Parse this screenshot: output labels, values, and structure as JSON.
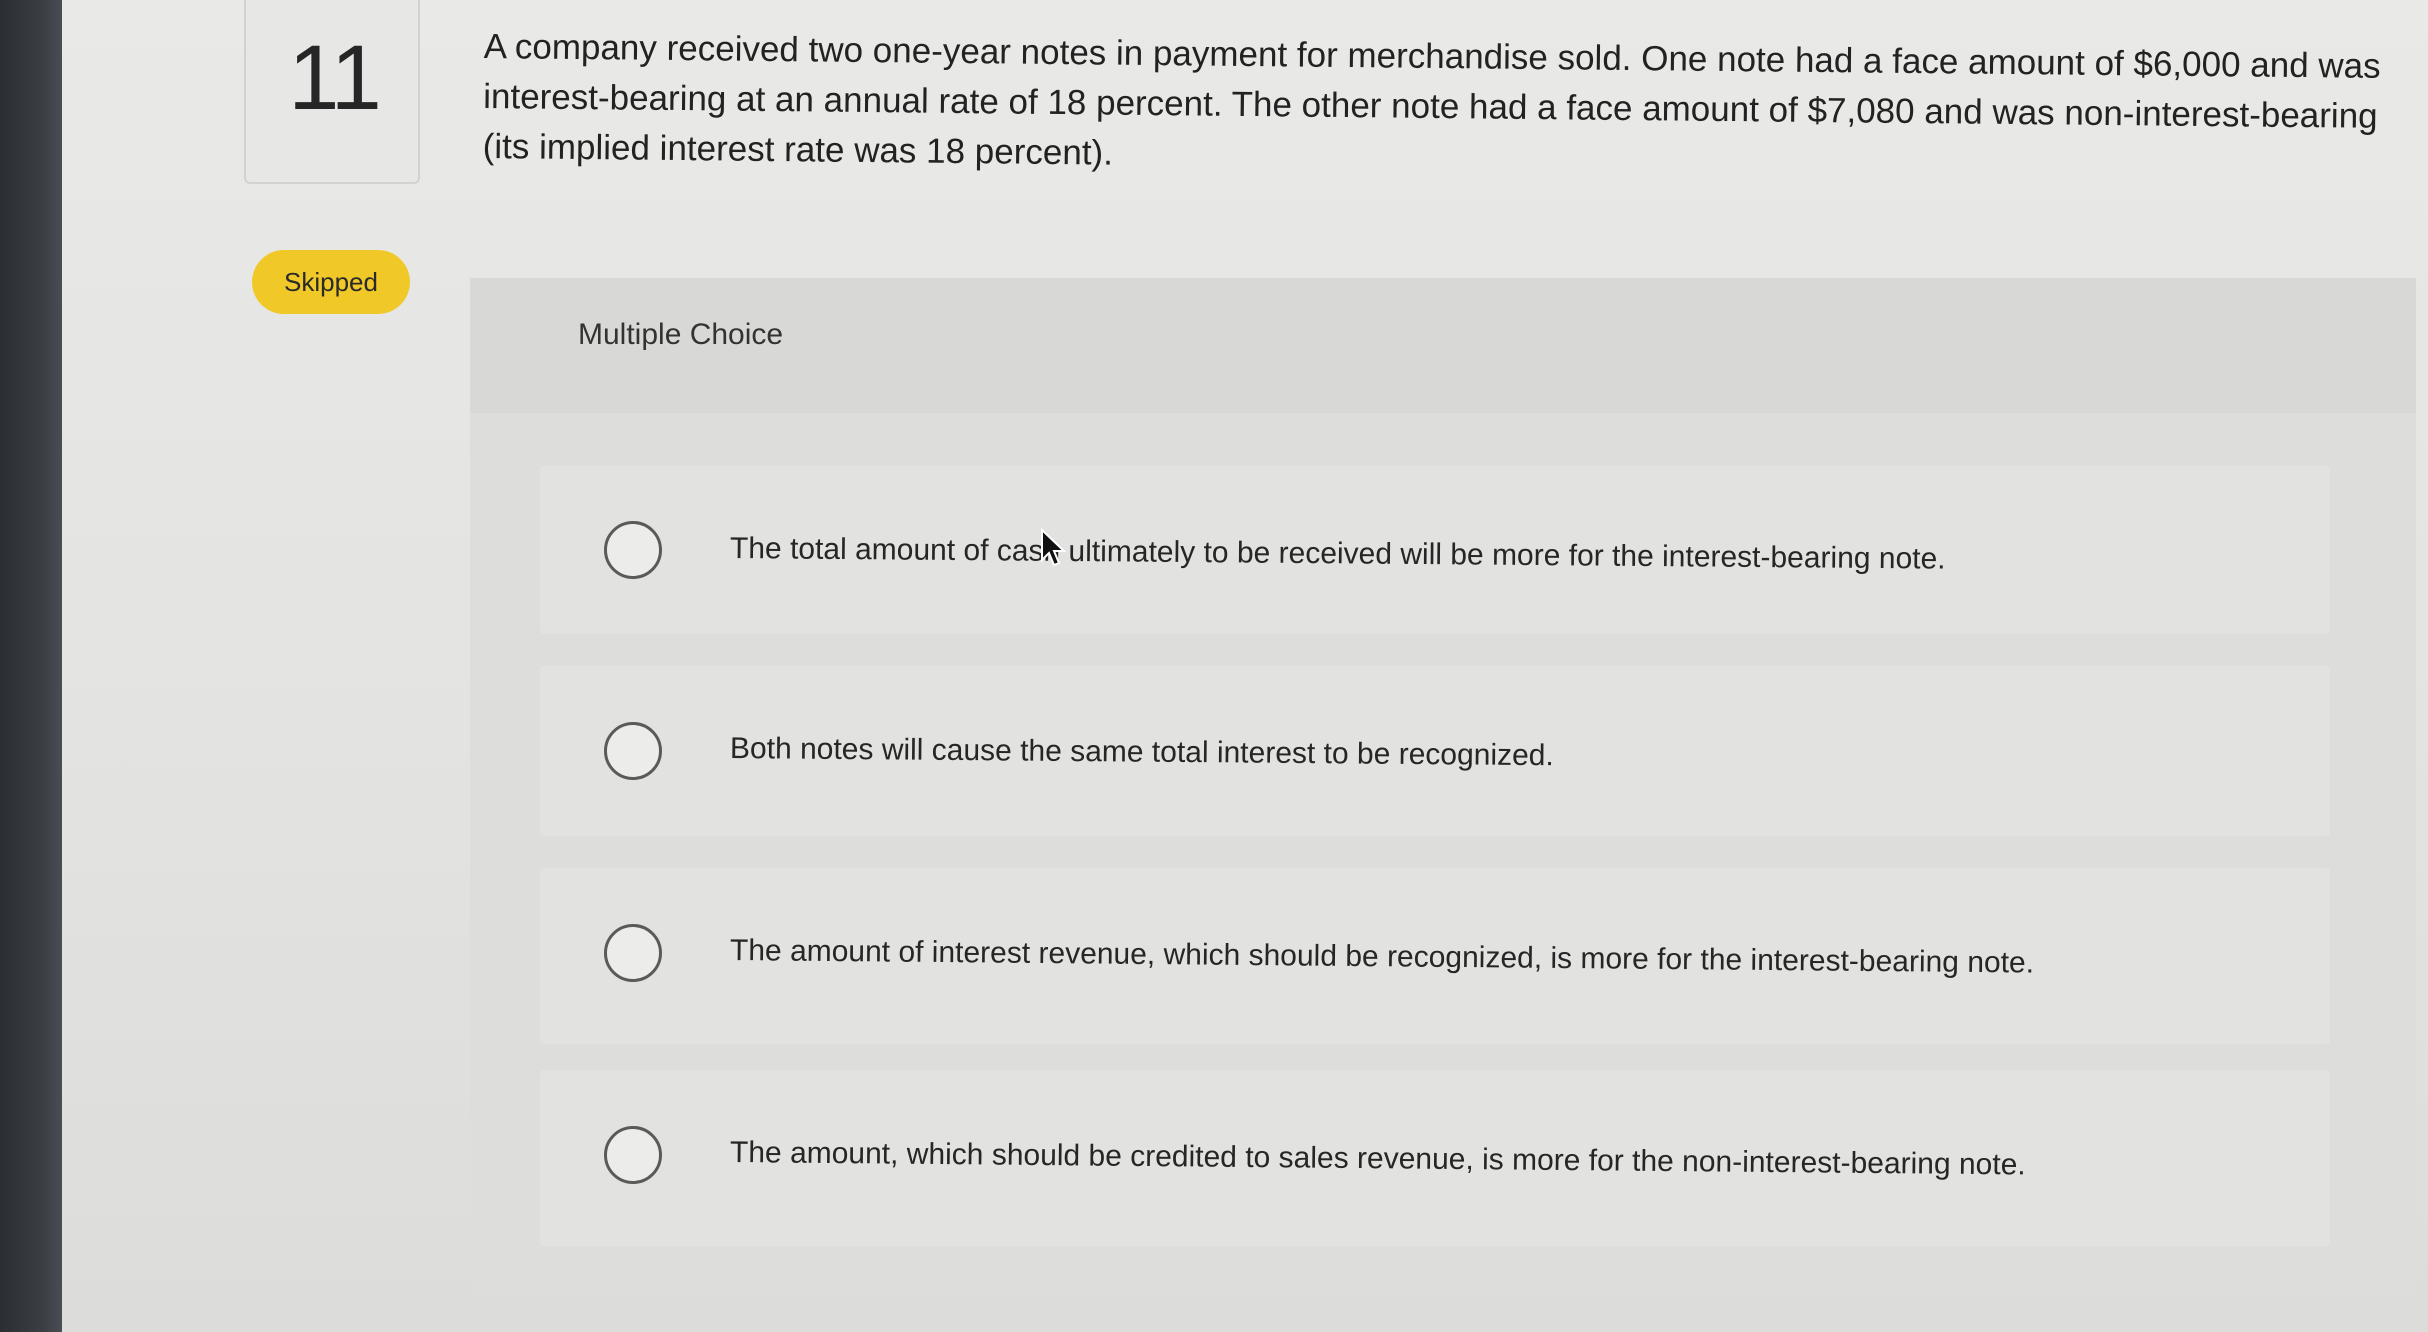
{
  "question": {
    "number": "11",
    "status": "Skipped",
    "text": "A company received two one-year notes in payment for merchandise sold. One note had a face amount of $6,000 and was interest-bearing at an annual rate of 18 percent. The other note had a face amount of $7,080 and was non-interest-bearing (its implied interest rate was 18 percent)."
  },
  "choices": {
    "heading": "Multiple Choice",
    "options": [
      {
        "label": "The total amount of cash ultimately to be received will be more for the interest-bearing note."
      },
      {
        "label": "Both notes will cause the same total interest to be recognized."
      },
      {
        "label": "The amount of interest revenue, which should be recognized, is more for the interest-bearing note."
      },
      {
        "label": "The amount, which should be credited to sales revenue, is more for the non-interest-bearing note."
      }
    ]
  },
  "icons": {
    "mouse_pointer": "cursor-arrow-icon",
    "radio": "radio-unselected-icon"
  },
  "colors": {
    "skipped_badge": "#f0c928",
    "background": "#e4e4e2"
  }
}
